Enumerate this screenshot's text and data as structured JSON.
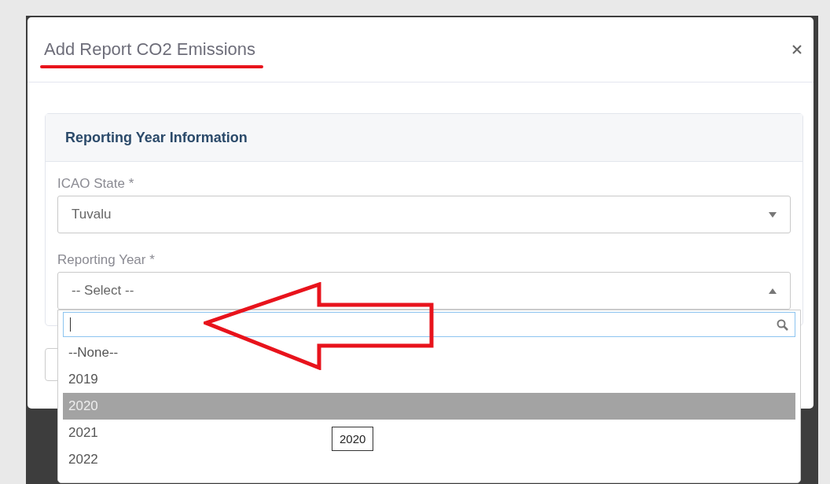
{
  "dialog": {
    "title": "Add Report CO2 Emissions"
  },
  "panel": {
    "title": "Reporting Year Information",
    "fields": [
      {
        "label": "ICAO State *",
        "value": "Tuvalu",
        "expanded": false
      },
      {
        "label": "Reporting Year *",
        "value": "-- Select --",
        "expanded": true
      }
    ]
  },
  "dropdown": {
    "options": [
      {
        "label": "--None--",
        "selected": false
      },
      {
        "label": "2019",
        "selected": false
      },
      {
        "label": "2020",
        "selected": true
      },
      {
        "label": "2021",
        "selected": false
      },
      {
        "label": "2022",
        "selected": false
      }
    ],
    "tooltip": "2020"
  }
}
